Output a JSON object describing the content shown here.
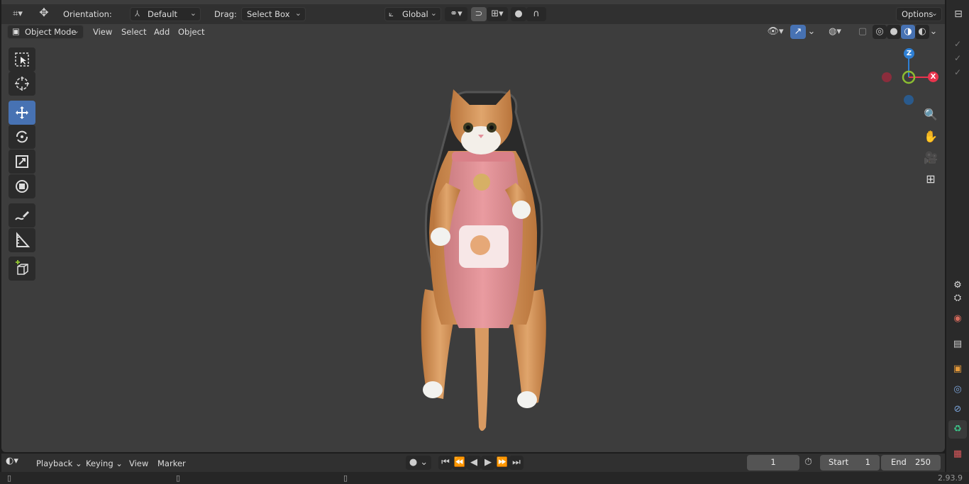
{
  "header": {
    "orientation_label": "Orientation:",
    "orientation_value": "Default",
    "drag_label": "Drag:",
    "drag_value": "Select Box",
    "transform_orientation": "Global",
    "options_label": "Options"
  },
  "viewport_header": {
    "mode": "Object Mode",
    "menus": [
      "View",
      "Select",
      "Add",
      "Object"
    ]
  },
  "gizmo": {
    "z": "Z",
    "x": "X"
  },
  "timeline": {
    "menus": [
      "Playback",
      "Keying",
      "View",
      "Marker"
    ],
    "current_frame": "1",
    "start_label": "Start",
    "start_value": "1",
    "end_label": "End",
    "end_value": "250"
  },
  "status": {
    "version": "2.93.9"
  },
  "colors": {
    "accent": "#4772b3",
    "viewport_bg": "#3d3d3d",
    "axis_x": "#e8344d",
    "axis_y": "#8bbd31",
    "axis_z": "#2e7fd4"
  }
}
